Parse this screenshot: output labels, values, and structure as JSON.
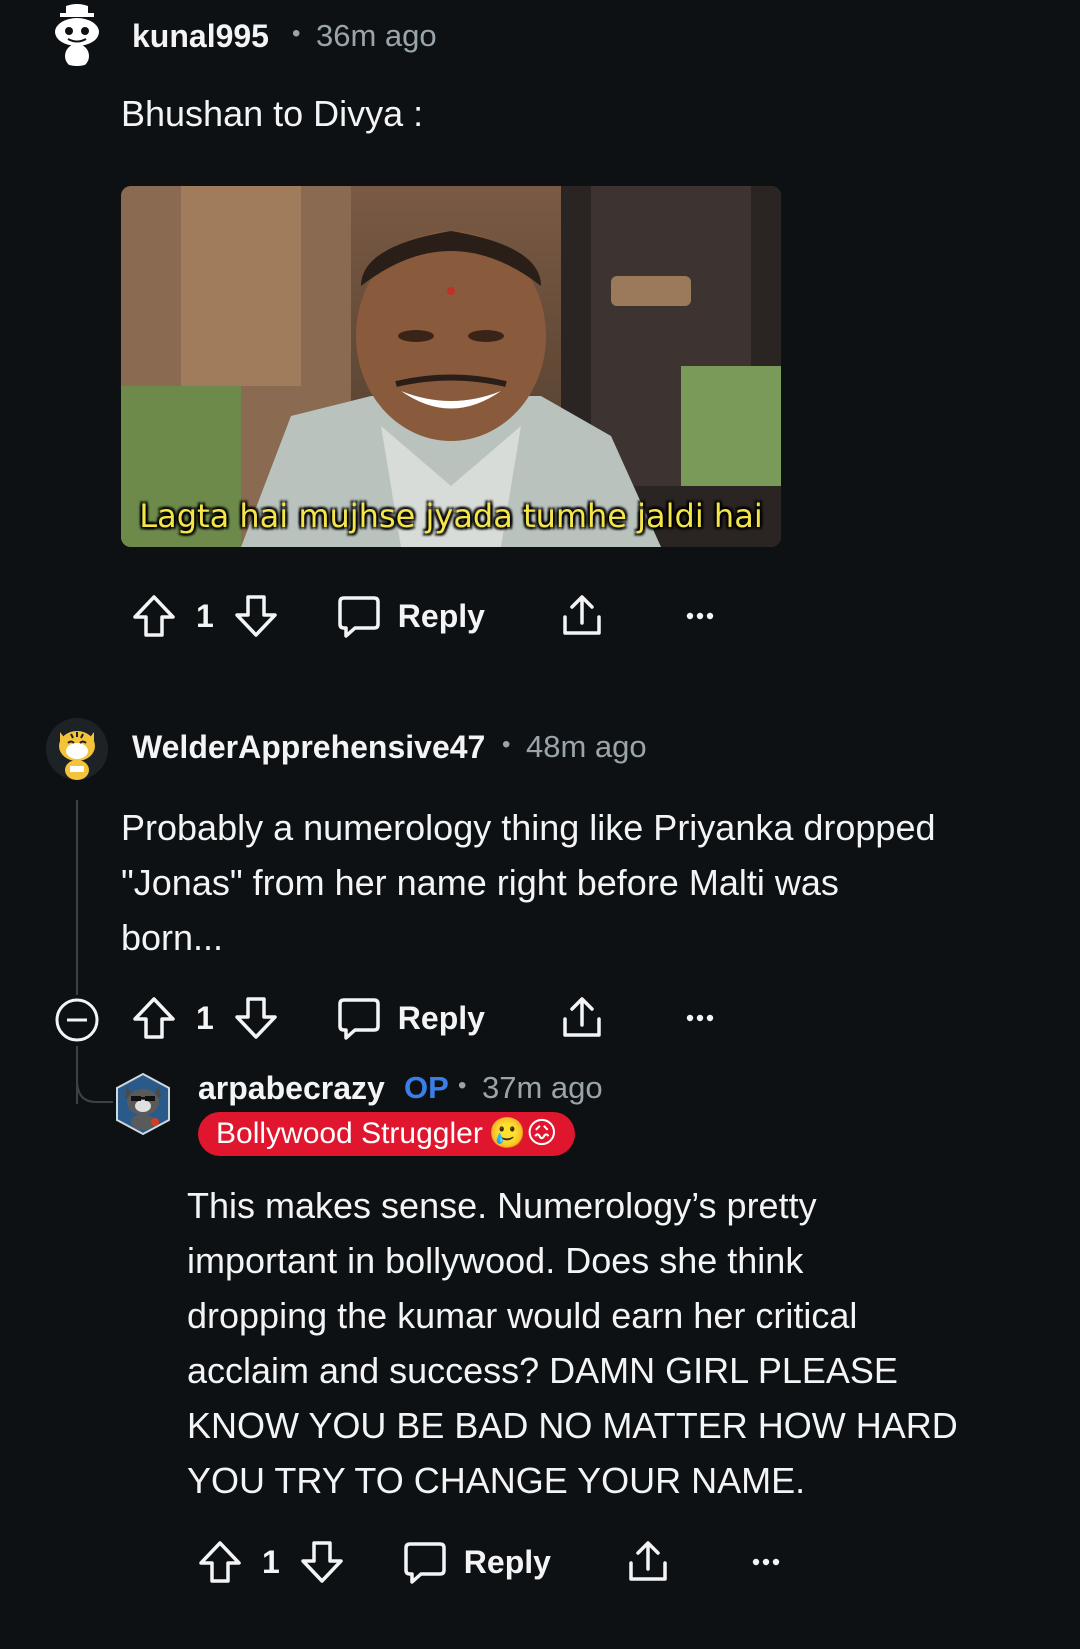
{
  "comments": [
    {
      "username": "kunal995",
      "time": "36m ago",
      "body": [
        "Bhushan to Divya :"
      ],
      "image_caption": "Lagta hai mujhse jyada tumhe jaldi hai",
      "votes": "1",
      "reply_label": "Reply"
    },
    {
      "username": "WelderApprehensive47",
      "time": "48m ago",
      "body": [
        "Probably a numerology thing like Priyanka dropped",
        "\"Jonas\" from her name right before Malti was",
        "born..."
      ],
      "votes": "1",
      "reply_label": "Reply"
    },
    {
      "username": "arpabecrazy",
      "op_tag": "OP",
      "time": "37m ago",
      "flair": "Bollywood Struggler",
      "flair_emojis": "🥲😖",
      "body": [
        "This makes sense. Numerology’s pretty",
        "important in bollywood. Does she think",
        "dropping the kumar would earn her critical",
        "acclaim and success? DAMN GIRL PLEASE",
        "KNOW YOU BE BAD NO MATTER HOW HARD",
        "YOU TRY TO CHANGE YOUR NAME."
      ],
      "votes": "1",
      "reply_label": "Reply"
    }
  ],
  "separator": "•",
  "colors": {
    "background": "#0e1113",
    "text": "#f2f4f5",
    "meta": "#9aa5ab",
    "op": "#3a7ee8",
    "flair_bg": "#e0152e"
  },
  "icons": [
    "upvote-icon",
    "downvote-icon",
    "comment-icon",
    "share-icon",
    "more-icon",
    "collapse-icon"
  ]
}
